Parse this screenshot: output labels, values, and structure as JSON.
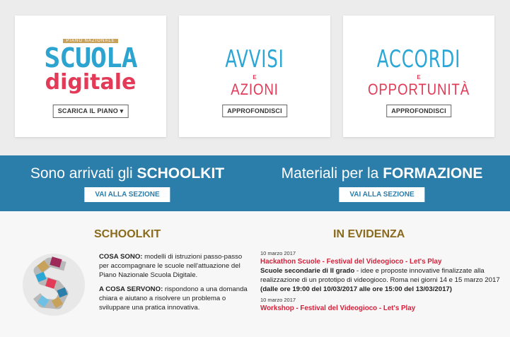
{
  "cards": [
    {
      "logo_top": "PIANO NAZIONALE",
      "logo_line1": "SCUOLA",
      "logo_line2": "digitale",
      "button": "SCARICA IL PIANO ▾"
    },
    {
      "logo_line1": "AVVISI",
      "logo_e": "E",
      "logo_line2": "AZIONI",
      "button": "APPROFONDISCI"
    },
    {
      "logo_line1": "ACCORDI",
      "logo_e": "E",
      "logo_line2": "OPPORTUNITÀ",
      "button": "APPROFONDISCI"
    }
  ],
  "band": {
    "left_prefix": "Sono arrivati gli ",
    "left_bold": "SCHOOLKIT",
    "left_button": "VAI ALLA SEZIONE",
    "right_prefix": "Materiali per la ",
    "right_bold": "FORMAZIONE",
    "right_button": "VAI ALLA SEZIONE"
  },
  "schoolkit": {
    "heading": "SCHOOLKIT",
    "cosa_sono_label": "COSA SONO:",
    "cosa_sono_text": " modelli di istruzioni passo-passo per accompagnare le scuole nell'attuazione del Piano Nazionale Scuola Digitale.",
    "cosa_servono_label": "A COSA SERVONO:",
    "cosa_servono_text": " rispondono a una domanda chiara e aiutano a risolvere un problema o sviluppare una pratica innovativa."
  },
  "evidenza": {
    "heading": "IN EVIDENZA",
    "items": [
      {
        "date": "10 marzo 2017",
        "title": "Hackathon Scuole - Festival del Videogioco - Let's Play",
        "desc_bold": "Scuole secondarie di II grado",
        "desc_text": " - idee e proposte innovative finalizzate alla realizzazione di un prototipo di videogioco. Roma nei giorni 14 e 15 marzo 2017 ",
        "desc_bold2": "(dalle ore 19:00 del 10/03/2017 alle ore 15:00 del 13/03/2017)"
      },
      {
        "date": "10 marzo 2017",
        "title": "Workshop - Festival del Videogioco - Let's Play"
      }
    ]
  },
  "colors": {
    "band": "#2b7daa",
    "heading_gold": "#8a6a1d",
    "link_red": "#d6203a",
    "logo_blue": "#2aa7d6"
  }
}
